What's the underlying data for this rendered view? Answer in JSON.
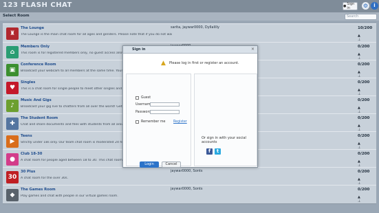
{
  "app": {
    "logo": "123 FLASH CHAT",
    "sign_in_label": "Sign in",
    "select_title": "Select Room",
    "search_placeholder": "Search"
  },
  "rooms": [
    {
      "name": "The Lounge",
      "desc": "The Lounge is the main chat room for all ages and genders. Please note that if you do not want to follow chat rules, you can create your own private chat rooms.",
      "users": "sarita, jaywar0000, Dyllalilly",
      "count": "10/200",
      "icon": "lounge-icon",
      "color": "#b1282f"
    },
    {
      "name": "Members Only",
      "desc": "This room is for registered members only, no guest access allowed.",
      "users": "jaywar0000",
      "count": "0/200",
      "icon": "members-icon",
      "color": "#2a9d73"
    },
    {
      "name": "Conference Room",
      "desc": "Broadcast your webcam to all members at the same time. Your video will be shared.",
      "users": "",
      "count": "0/200",
      "icon": "conference-icon",
      "color": "#3b8f2f"
    },
    {
      "name": "Singles",
      "desc": "This is a chat room for single people to meet other singles and hook up online.",
      "users": "",
      "count": "0/200",
      "icon": "heart-icon",
      "color": "#c4182a"
    },
    {
      "name": "Music And Gigs",
      "desc": "Broadcast your gig live to chatters from all over the world! Get our music and gig updates.",
      "users": "",
      "count": "0/200",
      "icon": "music-icon",
      "color": "#6c9f2f"
    },
    {
      "name": "The Student Room",
      "desc": "Chat and share documents and files with students from all around the world.",
      "users": "",
      "count": "0/200",
      "icon": "student-icon",
      "color": "#5475a0"
    },
    {
      "name": "Teens",
      "desc": "Strictly under 18s only. Our team chat room is moderated 24 hours a day, we",
      "users": "",
      "count": "0/200",
      "icon": "teens-icon",
      "color": "#d96d1b"
    },
    {
      "name": "Club 18-30",
      "desc": "A chat room for people aged between 18 to 30. This chat room is open to everyone",
      "users": "",
      "count": "0/200",
      "icon": "club-icon",
      "color": "#d33c8a"
    },
    {
      "name": "30 Plus",
      "desc": "A chat room for the over 30s.",
      "users": "jaywar0000, Sonts",
      "count": "0/200",
      "icon": "thirty-plus-icon",
      "color": "#bf1f23"
    },
    {
      "name": "The Games Room",
      "desc": "Play games and chat with people in our virtual games room.",
      "users": "jaywar0000, Sonts",
      "count": "0/200",
      "icon": "game-icon",
      "color": "#59626b"
    }
  ],
  "modal": {
    "title": "Sign in",
    "warning": "Please log in first or register an account.",
    "guest": "Guest",
    "username": "Username:",
    "password": "Password:",
    "remember": "Remember me",
    "register": "Register",
    "login": "Login",
    "cancel": "Cancel",
    "social": "Or sign in with your social accounts"
  }
}
